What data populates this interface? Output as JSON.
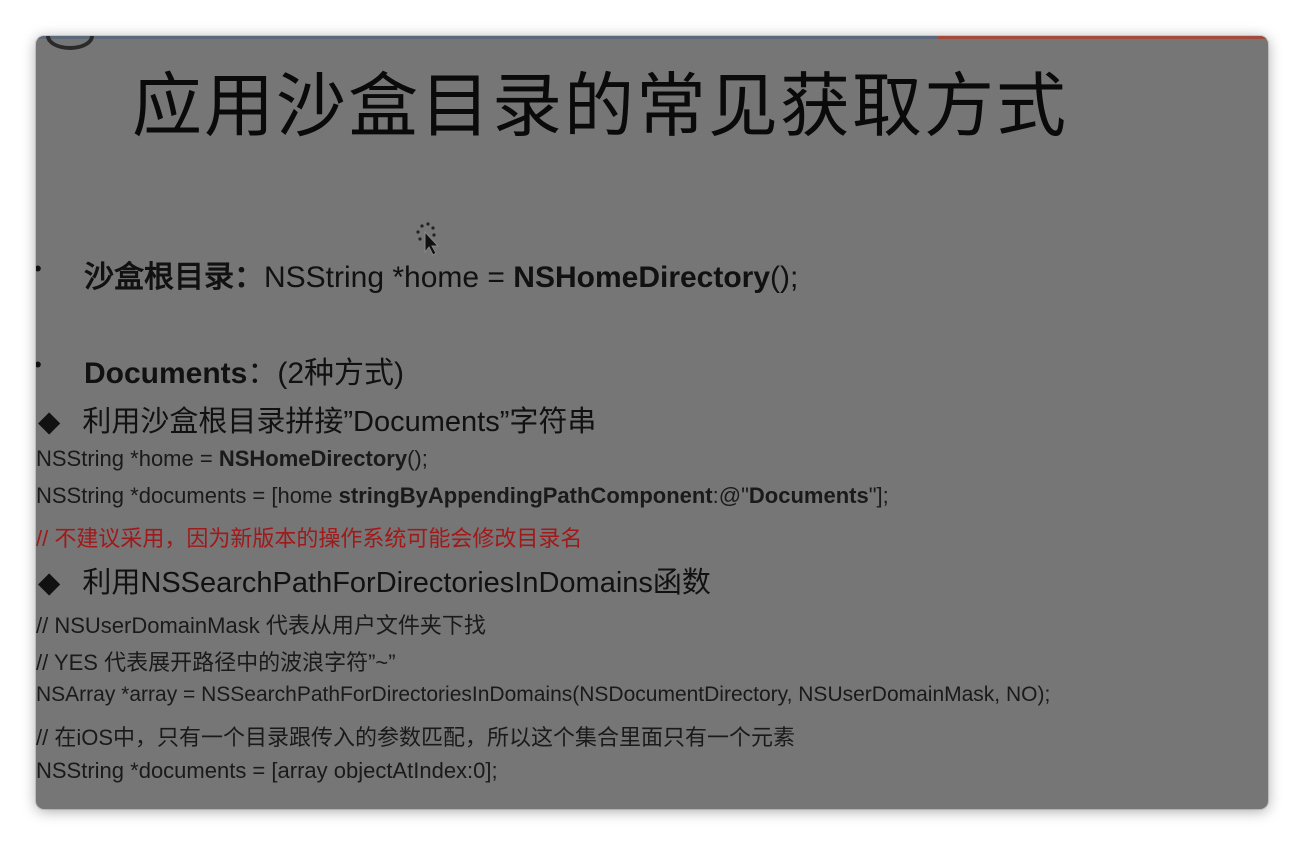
{
  "slide": {
    "title": "应用沙盒目录的常见获取方式",
    "bullet1": {
      "marker": "•",
      "label": "沙盒根目录：",
      "code_prefix": "NSString *home = ",
      "code_bold": "NSHomeDirectory",
      "code_suffix": "();"
    },
    "bullet2": {
      "marker": "•",
      "label": "Documents",
      "suffix": "：(2种方式)"
    },
    "method1": {
      "marker": "◆",
      "heading": "利用沙盒根目录拼接”Documents”字符串",
      "line1_prefix": "NSString *home = ",
      "line1_bold": "NSHomeDirectory",
      "line1_suffix": "();",
      "line2_prefix": "NSString *documents = [home ",
      "line2_bold1": "stringByAppendingPathComponent",
      "line2_mid": ":@\"",
      "line2_bold2": "Documents",
      "line2_suffix": "\"];",
      "comment": "// 不建议采用，因为新版本的操作系统可能会修改目录名"
    },
    "method2": {
      "marker": "◆",
      "heading": "利用NSSearchPathForDirectoriesInDomains函数",
      "comment1": "// NSUserDomainMask 代表从用户文件夹下找",
      "comment2": "// YES 代表展开路径中的波浪字符”~”",
      "code1": "NSArray *array =  NSSearchPathForDirectoriesInDomains(NSDocumentDirectory, NSUserDomainMask, NO);",
      "comment3": "// 在iOS中，只有一个目录跟传入的参数匹配，所以这个集合里面只有一个元素",
      "code2": "NSString *documents = [array objectAtIndex:0];"
    }
  },
  "colors": {
    "background": "#767676",
    "text": "#111111",
    "comment_red": "#a0191b"
  },
  "icons": {
    "cursor": "busy-cursor-icon"
  }
}
